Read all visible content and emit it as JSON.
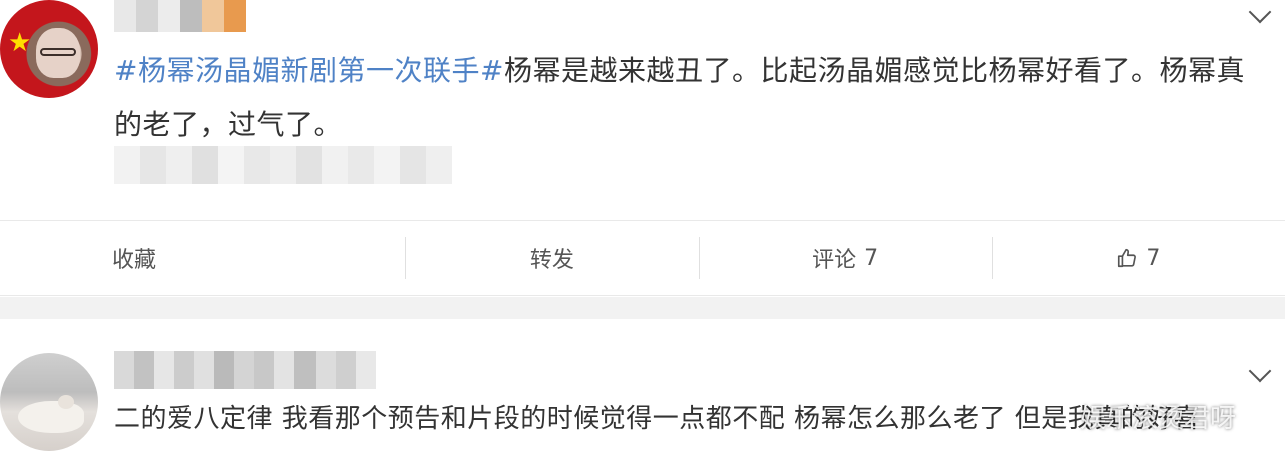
{
  "post": {
    "hashtag": "#杨幂汤晶媚新剧第一次联手#",
    "text": "杨幂是越来越丑了。比起汤晶媚感觉比杨幂好看了。杨幂真的老了，过气了。",
    "actions": {
      "favorite_label": "收藏",
      "repost_label": "转发",
      "comment_label": "评论",
      "comment_count": "7",
      "like_count": "7"
    }
  },
  "comment": {
    "text": "二的爱八定律 我看那个预告和片段的时候觉得一点都不配 杨幂怎么那么老了 但是我真的好喜",
    "watermark": "娱乐滚烫君呀"
  },
  "icons": [
    "chevron-down-icon",
    "thumbs-up-icon"
  ],
  "colors": {
    "hashtag": "#4f82c6",
    "text": "#333333",
    "divider": "#e9e9e9",
    "gap": "#f2f2f2"
  }
}
